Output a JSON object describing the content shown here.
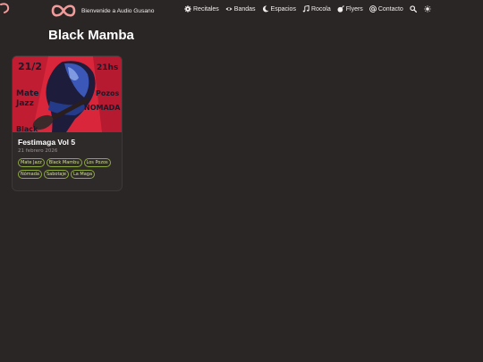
{
  "site": {
    "brand_text": "Bienvenide a Audio Gusano",
    "brand_color": "#f29b9b"
  },
  "nav": {
    "items": [
      {
        "label": "Recitales",
        "icon": "gear-icon"
      },
      {
        "label": "Bandas",
        "icon": "eye-icon"
      },
      {
        "label": "Espacios",
        "icon": "moon-icon"
      },
      {
        "label": "Rocola",
        "icon": "music-note-icon"
      },
      {
        "label": "Flyers",
        "icon": "bomb-icon"
      },
      {
        "label": "Contacto",
        "icon": "at-icon"
      }
    ],
    "search_icon": "search-icon",
    "theme_icon": "sun-icon"
  },
  "page": {
    "title": "Black Mamba"
  },
  "cards": [
    {
      "title": "Festimaga Vol 5",
      "date": "21 febrero 2026",
      "flyer_lettering": [
        "21/2",
        "21hs",
        "Mate",
        "Jazz",
        "Pozos",
        "NOMADA",
        "Black"
      ],
      "tags": [
        "Mate Jazz",
        "Black Mambu",
        "Los Pozos",
        "Nómada",
        "Sabotaje",
        "La Maga"
      ]
    }
  ],
  "colors": {
    "background": "#2a2626",
    "card_background": "#2f2a2a",
    "tag_border": "#8aa93a",
    "tag_text": "#cfe08a",
    "flyer_red": "#d9263b",
    "flyer_blue": "#3b57b8"
  }
}
